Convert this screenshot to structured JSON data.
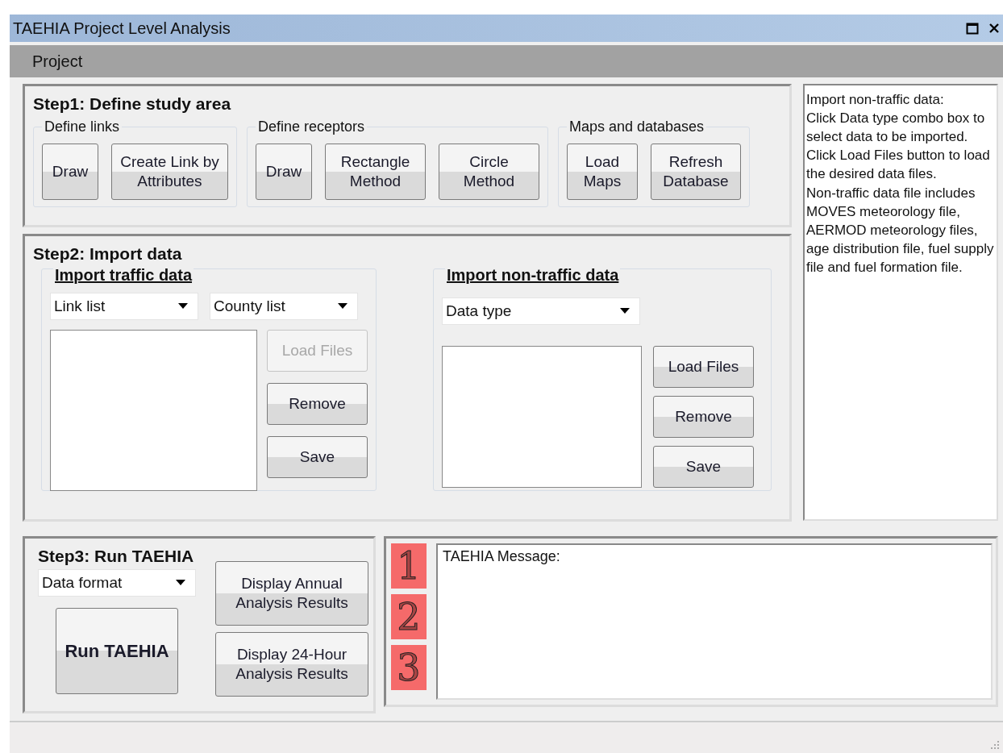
{
  "window": {
    "title": "TAEHIA Project Level Analysis"
  },
  "menu": [
    {
      "label": "Project"
    }
  ],
  "step1": {
    "title": "Step1: Define study area",
    "groups": [
      {
        "label": "Define links",
        "buttons": [
          {
            "label": "Draw",
            "disabled": false
          },
          {
            "label": "Create Link by Attributes",
            "disabled": false
          }
        ]
      },
      {
        "label": "Define receptors",
        "buttons": [
          {
            "label": "Draw",
            "disabled": false
          },
          {
            "label": "Rectangle Method",
            "disabled": false
          },
          {
            "label": "Circle Method",
            "disabled": false
          }
        ]
      },
      {
        "label": "Maps and databases",
        "buttons": [
          {
            "label": "Load Maps",
            "disabled": false
          },
          {
            "label": "Refresh Database",
            "disabled": false
          }
        ]
      }
    ]
  },
  "step2": {
    "title": "Step2: Import data",
    "sections": [
      {
        "title": "Import traffic data",
        "combos": [
          {
            "value": "Link list"
          },
          {
            "value": "County list"
          }
        ],
        "buttons": [
          {
            "label": "Load Files",
            "disabled": true
          },
          {
            "label": "Remove",
            "disabled": false
          },
          {
            "label": "Save",
            "disabled": false
          }
        ]
      },
      {
        "title": "Import non-traffic data",
        "combos": [
          {
            "value": "Data type"
          }
        ],
        "buttons": [
          {
            "label": "Load Files",
            "disabled": false
          },
          {
            "label": "Remove",
            "disabled": false
          },
          {
            "label": "Save",
            "disabled": false
          }
        ]
      }
    ]
  },
  "help": [
    "Import non-traffic data:",
    "Click Data type combo box to select data to be imported.",
    "Click Load Files button to load the desired data files.",
    "Non-traffic data file includes MOVES meteorology file, AERMOD meteorology files, age distribution file, fuel supply file and fuel formation file."
  ],
  "step3": {
    "title": "Step3: Run TAEHIA",
    "combo": {
      "value": "Data format"
    },
    "run_button": {
      "label": "Run TAEHIA",
      "disabled": false
    },
    "buttons": [
      {
        "label": "Display Annual Analysis Results",
        "disabled": false
      },
      {
        "label": "Display 24-Hour Analysis Results",
        "disabled": false
      }
    ]
  },
  "message": {
    "badges": [
      "1",
      "2",
      "3"
    ],
    "text": "TAEHIA Message:"
  }
}
